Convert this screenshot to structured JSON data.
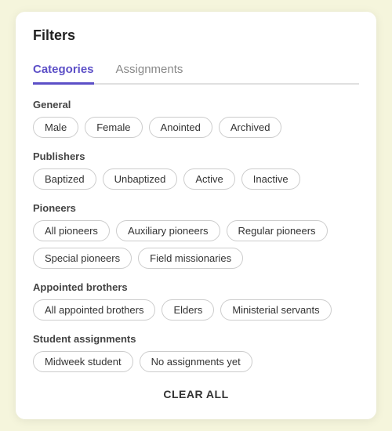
{
  "panel": {
    "title": "Filters"
  },
  "tabs": [
    {
      "id": "categories",
      "label": "Categories",
      "active": true
    },
    {
      "id": "assignments",
      "label": "Assignments",
      "active": false
    }
  ],
  "sections": [
    {
      "id": "general",
      "label": "General",
      "chips": [
        "Male",
        "Female",
        "Anointed",
        "Archived"
      ]
    },
    {
      "id": "publishers",
      "label": "Publishers",
      "chips": [
        "Baptized",
        "Unbaptized",
        "Active",
        "Inactive"
      ]
    },
    {
      "id": "pioneers",
      "label": "Pioneers",
      "chips": [
        "All pioneers",
        "Auxiliary pioneers",
        "Regular pioneers",
        "Special pioneers",
        "Field missionaries"
      ]
    },
    {
      "id": "appointed-brothers",
      "label": "Appointed brothers",
      "chips": [
        "All appointed brothers",
        "Elders",
        "Ministerial servants"
      ]
    },
    {
      "id": "student-assignments",
      "label": "Student assignments",
      "chips": [
        "Midweek student",
        "No assignments yet"
      ]
    }
  ],
  "clear_all_label": "CLEAR ALL"
}
